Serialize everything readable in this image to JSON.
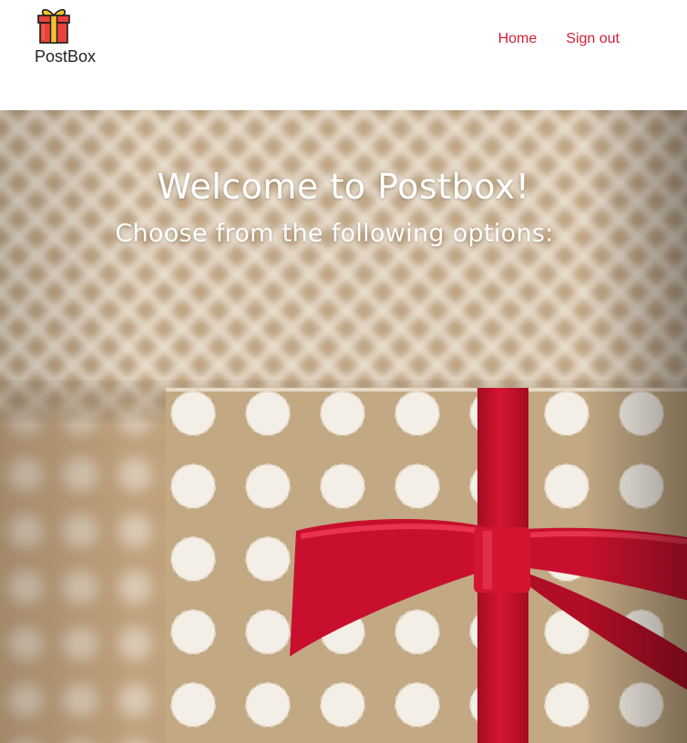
{
  "brand": {
    "name": "PostBox",
    "logo_icon": "gift-icon"
  },
  "nav": {
    "items": [
      {
        "label": "Home"
      },
      {
        "label": "Sign out"
      }
    ]
  },
  "hero": {
    "title": "Welcome to Postbox!",
    "subtitle": "Choose from the following options:",
    "background_image": "gift-box-photo"
  },
  "colors": {
    "accent": "#d0203a",
    "paper": "#c6ad8c",
    "ribbon": "#c8102e"
  }
}
